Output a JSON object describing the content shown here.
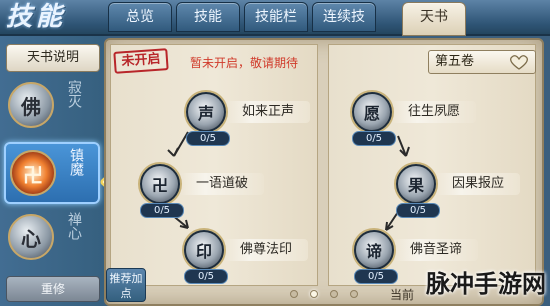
{
  "header": {
    "logo": "技能",
    "tabs": [
      {
        "label": "总览",
        "active": false
      },
      {
        "label": "技能",
        "active": false
      },
      {
        "label": "技能栏",
        "active": false
      },
      {
        "label": "连续技",
        "active": false
      },
      {
        "label": "天书",
        "active": true
      }
    ]
  },
  "sidebar": {
    "title": "天书说明",
    "skills": [
      {
        "name": "寂灭",
        "icon": "buddha-seal-icon",
        "glyph": "佛",
        "active": false
      },
      {
        "name": "镇魔",
        "icon": "flame-seal-icon",
        "glyph": "卍",
        "active": true
      },
      {
        "name": "禅心",
        "icon": "lotus-icon",
        "glyph": "心",
        "active": false
      }
    ],
    "reset_label": "重修"
  },
  "book": {
    "stamp": "未开启",
    "notice": "暂未开启，敬请期待",
    "volume": "第五卷",
    "volume_icon": "heart-lock-icon",
    "left_nodes": [
      {
        "name": "如来正声",
        "count": "0/5",
        "glyph": "声"
      },
      {
        "name": "一语道破",
        "count": "0/5",
        "glyph": "卍"
      },
      {
        "name": "佛尊法印",
        "count": "0/5",
        "glyph": "印"
      }
    ],
    "right_nodes": [
      {
        "name": "往生夙愿",
        "count": "0/5",
        "glyph": "愿"
      },
      {
        "name": "因果报应",
        "count": "0/5",
        "glyph": "果"
      },
      {
        "name": "佛音圣谛",
        "count": "0/5",
        "glyph": "谛"
      }
    ]
  },
  "footer": {
    "recommend": "推荐加点",
    "page_dots": 4,
    "current_page": 1,
    "text": "当前",
    "watermark": "脉冲手游网"
  },
  "colors": {
    "tab_blue": "#315a7d",
    "active_tab": "#f7f2e6",
    "notice_red": "#d03a2a",
    "parchment": "#efe8d8"
  }
}
